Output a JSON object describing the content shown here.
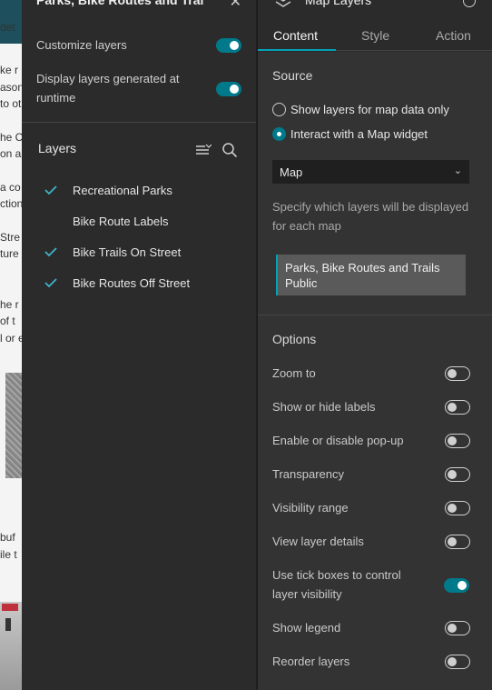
{
  "page_fragments": [
    "det",
    "ke r",
    "ason",
    "to ot",
    "he C",
    "on a",
    "a co",
    "ction.",
    "Stre",
    "ture",
    "he r",
    "of t",
    "l or e",
    "buf",
    "ile t"
  ],
  "left_panel": {
    "title": "Parks, Bike Routes and Trai",
    "customize_layers": "Customize layers",
    "display_layers_runtime": "Display layers generated at runtime",
    "layers_heading": "Layers",
    "layers": [
      {
        "label": "Recreational Parks",
        "checked": true
      },
      {
        "label": "Bike Route Labels",
        "checked": false
      },
      {
        "label": "Bike Trails On Street",
        "checked": true
      },
      {
        "label": "Bike Routes Off Street",
        "checked": true
      }
    ]
  },
  "right_panel": {
    "title": "Map Layers",
    "tabs": [
      {
        "label": "Content",
        "active": true
      },
      {
        "label": "Style",
        "active": false
      },
      {
        "label": "Action",
        "active": false
      }
    ],
    "source_heading": "Source",
    "radio_options": [
      {
        "label": "Show layers for map data only",
        "selected": false
      },
      {
        "label": "Interact with a Map widget",
        "selected": true
      }
    ],
    "map_select_value": "Map",
    "help_text": "Specify which layers will be displayed for each map",
    "map_card_text": "Parks, Bike Routes and Trails Public",
    "options_heading": "Options",
    "options": [
      {
        "label": "Zoom to",
        "on": false
      },
      {
        "label": "Show or hide labels",
        "on": false
      },
      {
        "label": "Enable or disable pop-up",
        "on": false
      },
      {
        "label": "Transparency",
        "on": false
      },
      {
        "label": "Visibility range",
        "on": false
      },
      {
        "label": "View layer details",
        "on": false
      },
      {
        "label": "Use tick boxes to control layer visibility",
        "on": true
      },
      {
        "label": "Show legend",
        "on": false
      },
      {
        "label": "Reorder layers",
        "on": false
      }
    ]
  },
  "colors": {
    "accent": "#00798a",
    "tab_underline": "#00a3b8",
    "panel_bg": "#2b2b2b",
    "content_bg": "#333333"
  }
}
